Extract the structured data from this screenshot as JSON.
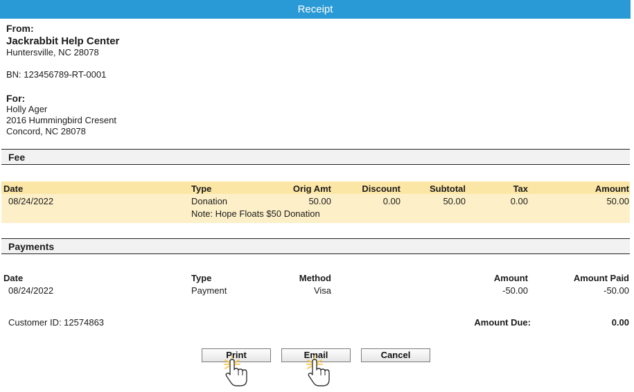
{
  "window": {
    "title": "Receipt"
  },
  "from": {
    "label": "From:",
    "org": "Jackrabbit Help Center",
    "city_line": "Huntersville, NC 28078",
    "bn": "BN: 123456789-RT-0001"
  },
  "for": {
    "label": "For:",
    "name": "Holly Ager",
    "street": "2016 Hummingbird Cresent",
    "city_line": "Concord, NC 28078"
  },
  "fee": {
    "section_title": "Fee",
    "headers": {
      "date": "Date",
      "type": "Type",
      "orig_amt": "Orig Amt",
      "discount": "Discount",
      "subtotal": "Subtotal",
      "tax": "Tax",
      "amount": "Amount"
    },
    "row": {
      "date": "08/24/2022",
      "type": "Donation",
      "orig_amt": "50.00",
      "discount": "0.00",
      "subtotal": "50.00",
      "tax": "0.00",
      "amount": "50.00"
    },
    "note": "Note: Hope Floats $50 Donation"
  },
  "payments": {
    "section_title": "Payments",
    "headers": {
      "date": "Date",
      "type": "Type",
      "method": "Method",
      "amount": "Amount",
      "amount_paid": "Amount Paid"
    },
    "row": {
      "date": "08/24/2022",
      "type": "Payment",
      "method": "Visa",
      "amount": "-50.00",
      "amount_paid": "-50.00"
    }
  },
  "footer": {
    "customer_id": "Customer ID: 12574863",
    "amount_due_label": "Amount Due:",
    "amount_due": "0.00"
  },
  "buttons": {
    "print": "Print",
    "email": "Email",
    "cancel": "Cancel"
  },
  "icons": {
    "cursor": "hand-pointer-icon"
  },
  "colors": {
    "titlebar": "#2a9ad6",
    "fee_row_bg": "#fdf0c8",
    "highlight": "#f5c542"
  }
}
